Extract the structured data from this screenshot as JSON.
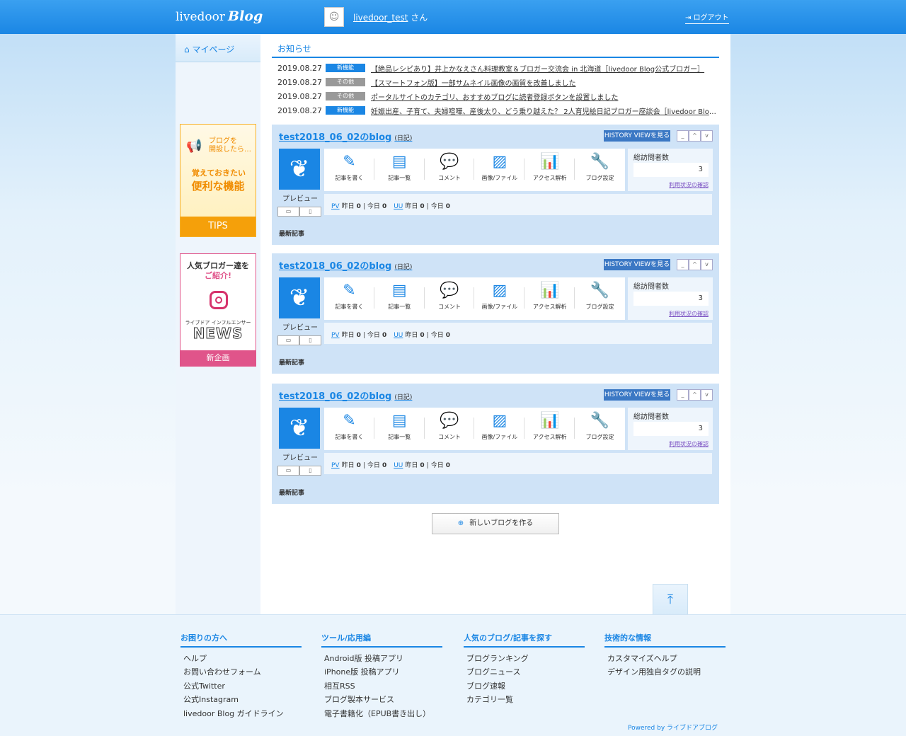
{
  "header": {
    "logo": "livedoor",
    "logo_em": "Blog",
    "username": "livedoor_test",
    "honorific": "さん",
    "logout": "ログアウト"
  },
  "sidebar": {
    "mypage": "マイページ",
    "tips": {
      "line1": "ブログを",
      "line2": "開設したら…",
      "heading": "覚えておきたい",
      "big": "便利な機能",
      "button": "TIPS"
    },
    "news": {
      "line1": "人気ブロガー達を",
      "line2": "ご紹介!",
      "sub": "ライブドア インフルエンサー",
      "logo": "NEWS",
      "button": "新企画"
    }
  },
  "notices": {
    "title": "お知らせ",
    "items": [
      {
        "date": "2019.08.27",
        "badge": "新機能",
        "badge_color": "#1a86e4",
        "text": "【絶品レシピあり】井上かなえさん料理教室＆ブロガー交流会 in 北海道［livedoor Blog公式ブロガー］"
      },
      {
        "date": "2019.08.27",
        "badge": "その他",
        "badge_color": "#999999",
        "text": "【スマートフォン版】一部サムネイル画像の画質を改善しました"
      },
      {
        "date": "2019.08.27",
        "badge": "その他",
        "badge_color": "#999999",
        "text": "ポータルサイトのカテゴリ、おすすめブログに読者登録ボタンを設置しました"
      },
      {
        "date": "2019.08.27",
        "badge": "新機能",
        "badge_color": "#1a86e4",
        "text": "妊娠出産、子育て、夫婦喧嘩、産後太り、どう乗り越えた？ 2人育児絵日記ブロガー座談会［livedoor Blog ..."
      }
    ]
  },
  "blog": {
    "title": "test2018_06_02のblog",
    "tag": "(日記)",
    "history": "HISTORY VIEWを見る",
    "ctrl_min": "_",
    "ctrl_up": "^",
    "ctrl_down": "v",
    "preview": "プレビュー",
    "dev_pc": "▭",
    "dev_sp": "▯",
    "tools": [
      "記事を書く",
      "記事一覧",
      "コメント",
      "画像/ファイル",
      "アクセス解析",
      "ブログ設定"
    ],
    "visitors_label": "総訪問者数",
    "visitors": "3",
    "usage_link": "利用状況の確認",
    "pv": "PV",
    "uu": "UU",
    "yesterday": "昨日",
    "today": "今日",
    "zero": "0",
    "sep": "|",
    "latest": "最新記事"
  },
  "new_blog": "新しいブログを作る",
  "footer": {
    "cols": [
      {
        "title": "お困りの方へ",
        "items": [
          "ヘルプ",
          "お問い合わせフォーム",
          "公式Twitter",
          "公式Instagram",
          "livedoor Blog ガイドライン"
        ]
      },
      {
        "title": "ツール/応用編",
        "items": [
          "Android版 投稿アプリ",
          "iPhone版 投稿アプリ",
          "相互RSS",
          "ブログ製本サービス",
          "電子書籍化（EPUB書き出し）"
        ]
      },
      {
        "title": "人気のブログ/記事を探す",
        "items": [
          "ブログランキング",
          "ブログニュース",
          "ブログ速報",
          "カテゴリ一覧"
        ]
      },
      {
        "title": "技術的な情報",
        "items": [
          "カスタマイズヘルプ",
          "デザイン用独自タグの説明"
        ]
      }
    ],
    "powered": "Powered by ライブドアブログ"
  }
}
